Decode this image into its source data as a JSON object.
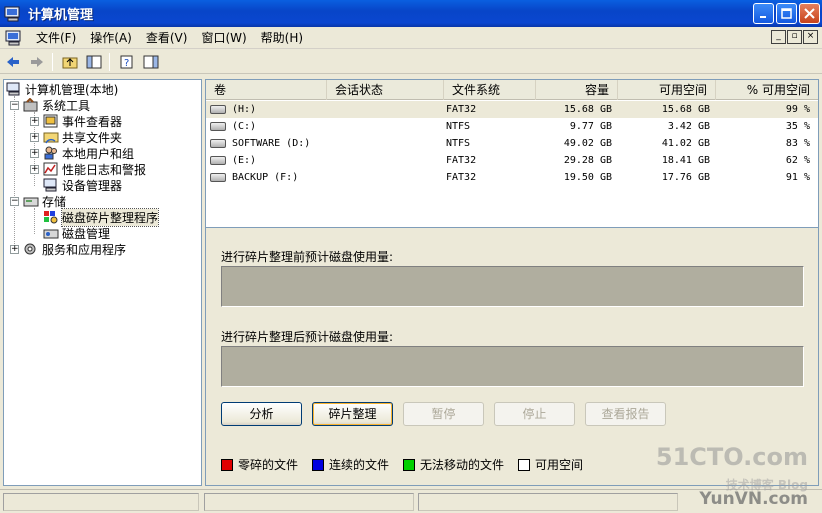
{
  "window": {
    "title": "计算机管理"
  },
  "menu": {
    "items": [
      "文件(F)",
      "操作(A)",
      "查看(V)",
      "窗口(W)",
      "帮助(H)"
    ]
  },
  "tree": {
    "items": [
      {
        "label": "计算机管理(本地)"
      },
      {
        "label": "系统工具"
      },
      {
        "label": "事件查看器"
      },
      {
        "label": "共享文件夹"
      },
      {
        "label": "本地用户和组"
      },
      {
        "label": "性能日志和警报"
      },
      {
        "label": "设备管理器"
      },
      {
        "label": "存储"
      },
      {
        "label": "磁盘碎片整理程序"
      },
      {
        "label": "磁盘管理"
      },
      {
        "label": "服务和应用程序"
      }
    ]
  },
  "volumes": {
    "columns": [
      "卷",
      "会话状态",
      "文件系统",
      "容量",
      "可用空间",
      "% 可用空间"
    ],
    "rows": [
      {
        "volume": "(H:)",
        "session": "",
        "fs": "FAT32",
        "capacity": "15.68 GB",
        "free": "15.68 GB",
        "pct": "99 %"
      },
      {
        "volume": "(C:)",
        "session": "",
        "fs": "NTFS",
        "capacity": "9.77 GB",
        "free": "3.42 GB",
        "pct": "35 %"
      },
      {
        "volume": "SOFTWARE (D:)",
        "session": "",
        "fs": "NTFS",
        "capacity": "49.02 GB",
        "free": "41.02 GB",
        "pct": "83 %"
      },
      {
        "volume": "(E:)",
        "session": "",
        "fs": "FAT32",
        "capacity": "29.28 GB",
        "free": "18.41 GB",
        "pct": "62 %"
      },
      {
        "volume": "BACKUP (F:)",
        "session": "",
        "fs": "FAT32",
        "capacity": "19.50 GB",
        "free": "17.76 GB",
        "pct": "91 %"
      }
    ]
  },
  "defrag": {
    "before_label": "进行碎片整理前预计磁盘使用量:",
    "after_label": "进行碎片整理后预计磁盘使用量:",
    "buttons": {
      "analyze": "分析",
      "defragment": "碎片整理",
      "pause": "暂停",
      "stop": "停止",
      "report": "查看报告"
    },
    "legend": [
      {
        "label": "零碎的文件",
        "color": "#e00000"
      },
      {
        "label": "连续的文件",
        "color": "#0000e0"
      },
      {
        "label": "无法移动的文件",
        "color": "#00d000"
      },
      {
        "label": "可用空间",
        "color": "#ffffff"
      }
    ]
  },
  "watermark": {
    "line1": "51CTO.com",
    "line2": "技术博客  Blog",
    "line3": "YunVN.com"
  }
}
